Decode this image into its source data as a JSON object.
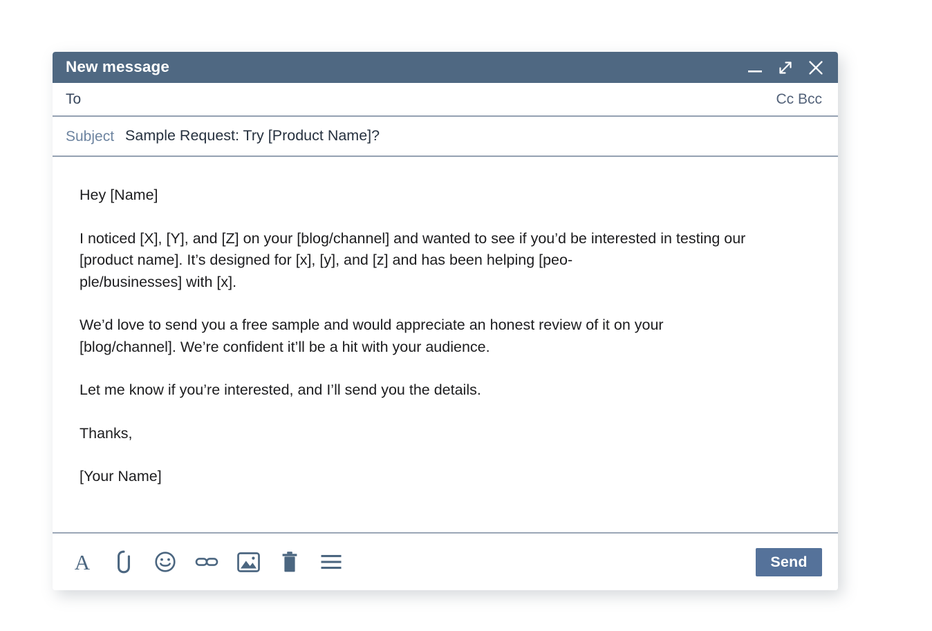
{
  "window": {
    "title": "New message",
    "controls": [
      {
        "name": "minimize-button",
        "label": "Minimize",
        "icon": "minimize-icon"
      },
      {
        "name": "expand-button",
        "label": "Expand",
        "icon": "expand-arrows-icon"
      },
      {
        "name": "close-button",
        "label": "Close",
        "icon": "close-icon"
      }
    ]
  },
  "fields": {
    "to": {
      "label": "To",
      "value": "",
      "placeholder": ""
    },
    "cc_bcc": "Cc Bcc",
    "subject": {
      "label": "Subject",
      "value": "Sample Request: Try [Product Name]?",
      "placeholder": ""
    }
  },
  "body": {
    "paragraphs": [
      "Hey [Name]",
      "I noticed [X], [Y], and [Z] on your [blog/channel] and wanted to see if you’d be interested in testing our [product name]. It’s designed for [x], [y], and [z] and has been helping [peo-\nple/businesses] with [x].",
      "We’d love to send you a free sample and would appreciate an honest review of it on your [blog/channel]. We’re confident it’ll be a hit with your audience.",
      "Let me know if you’re interested, and I’ll send you the details.",
      "Thanks,",
      "[Your Name]"
    ]
  },
  "toolbar": {
    "tools": [
      {
        "name": "formatting-options-button",
        "icon": "text-format-icon",
        "label": "A"
      },
      {
        "name": "attach-file-button",
        "icon": "paperclip-icon",
        "label": "Attach file"
      },
      {
        "name": "insert-emoji-button",
        "icon": "smiley-icon",
        "label": "Insert emoji"
      },
      {
        "name": "insert-link-button",
        "icon": "link-icon",
        "label": "Insert link"
      },
      {
        "name": "insert-image-button",
        "icon": "image-icon",
        "label": "Insert image"
      },
      {
        "name": "discard-draft-button",
        "icon": "trash-icon",
        "label": "Discard draft"
      },
      {
        "name": "more-options-button",
        "icon": "hamburger-menu-icon",
        "label": "More options"
      }
    ],
    "send_label": "Send"
  },
  "colors": {
    "titlebar": "#4f6882",
    "send_button": "#55729a",
    "separator": "#94a1b2",
    "subject_label": "#6d84a0",
    "body_text": "#1d1d1f",
    "icon": "#4b6680"
  }
}
